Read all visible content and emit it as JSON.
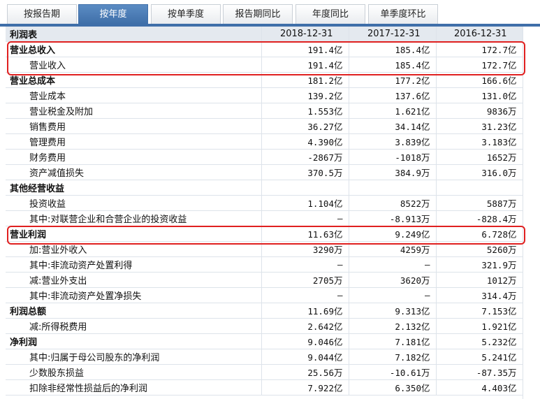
{
  "tabs": [
    {
      "label": "按报告期",
      "active": false
    },
    {
      "label": "按年度",
      "active": true
    },
    {
      "label": "按单季度",
      "active": false
    },
    {
      "label": "报告期同比",
      "active": false
    },
    {
      "label": "年度同比",
      "active": false
    },
    {
      "label": "单季度环比",
      "active": false
    }
  ],
  "header": {
    "title": "利润表",
    "periods": [
      "2018-12-31",
      "2017-12-31",
      "2016-12-31"
    ]
  },
  "rows": [
    {
      "label": "营业总收入",
      "type": "section",
      "values": [
        "191.4亿",
        "185.4亿",
        "172.7亿"
      ]
    },
    {
      "label": "营业收入",
      "type": "sub",
      "values": [
        "191.4亿",
        "185.4亿",
        "172.7亿"
      ]
    },
    {
      "label": "营业总成本",
      "type": "section",
      "values": [
        "181.2亿",
        "177.2亿",
        "166.6亿"
      ]
    },
    {
      "label": "营业成本",
      "type": "sub",
      "values": [
        "139.2亿",
        "137.6亿",
        "131.0亿"
      ]
    },
    {
      "label": "营业税金及附加",
      "type": "sub",
      "values": [
        "1.553亿",
        "1.621亿",
        "9836万"
      ]
    },
    {
      "label": "销售费用",
      "type": "sub",
      "values": [
        "36.27亿",
        "34.14亿",
        "31.23亿"
      ]
    },
    {
      "label": "管理费用",
      "type": "sub",
      "values": [
        "4.390亿",
        "3.839亿",
        "3.183亿"
      ]
    },
    {
      "label": "财务费用",
      "type": "sub",
      "values": [
        "-2867万",
        "-1018万",
        "1652万"
      ]
    },
    {
      "label": "资产减值损失",
      "type": "sub",
      "values": [
        "370.5万",
        "384.9万",
        "316.0万"
      ]
    },
    {
      "label": "其他经营收益",
      "type": "section",
      "values": [
        "",
        "",
        ""
      ]
    },
    {
      "label": "投资收益",
      "type": "sub",
      "values": [
        "1.104亿",
        "8522万",
        "5887万"
      ]
    },
    {
      "label": "其中:对联营企业和合营企业的投资收益",
      "type": "sub",
      "values": [
        "—",
        "-8.913万",
        "-828.4万"
      ]
    },
    {
      "label": "营业利润",
      "type": "section",
      "values": [
        "11.63亿",
        "9.249亿",
        "6.728亿"
      ]
    },
    {
      "label": "加:营业外收入",
      "type": "sub",
      "values": [
        "3290万",
        "4259万",
        "5260万"
      ]
    },
    {
      "label": "其中:非流动资产处置利得",
      "type": "sub",
      "values": [
        "—",
        "—",
        "321.9万"
      ]
    },
    {
      "label": "减:营业外支出",
      "type": "sub",
      "values": [
        "2705万",
        "3620万",
        "1012万"
      ]
    },
    {
      "label": "其中:非流动资产处置净损失",
      "type": "sub",
      "values": [
        "—",
        "—",
        "314.4万"
      ]
    },
    {
      "label": "利润总额",
      "type": "section",
      "values": [
        "11.69亿",
        "9.313亿",
        "7.153亿"
      ]
    },
    {
      "label": "减:所得税费用",
      "type": "sub",
      "values": [
        "2.642亿",
        "2.132亿",
        "1.921亿"
      ]
    },
    {
      "label": "净利润",
      "type": "section",
      "values": [
        "9.046亿",
        "7.181亿",
        "5.232亿"
      ]
    },
    {
      "label": "其中:归属于母公司股东的净利润",
      "type": "sub",
      "values": [
        "9.044亿",
        "7.182亿",
        "5.241亿"
      ]
    },
    {
      "label": "少数股东损益",
      "type": "sub",
      "values": [
        "25.56万",
        "-10.61万",
        "-87.35万"
      ]
    },
    {
      "label": "扣除非经常性损益后的净利润",
      "type": "sub",
      "values": [
        "7.922亿",
        "6.350亿",
        "4.403亿"
      ]
    }
  ],
  "colors": {
    "active_tab": "#3f6fa9",
    "highlight_border": "#e02020",
    "header_bg": "#e4e9ef"
  }
}
